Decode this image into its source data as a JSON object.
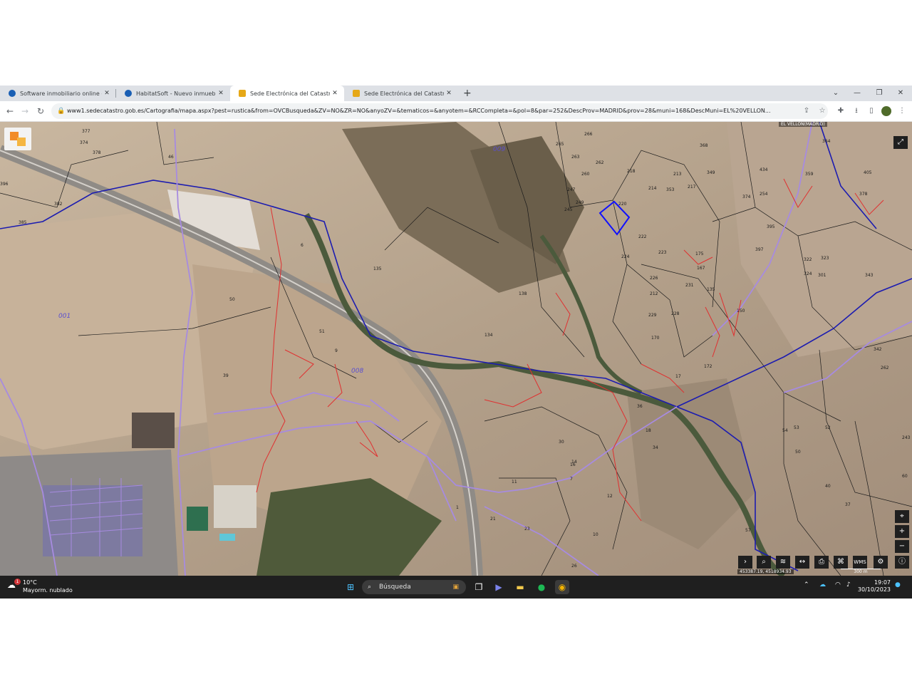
{
  "browser": {
    "tabs": [
      {
        "title": "Software inmobiliario online - H",
        "active": false,
        "icon": "habitatsoft-favicon"
      },
      {
        "title": "HabitatSoft - Nuevo inmueble",
        "active": false,
        "icon": "habitatsoft-favicon"
      },
      {
        "title": "Sede Electrónica del Catastro - ",
        "active": true,
        "icon": "catastro-favicon"
      },
      {
        "title": "Sede Electrónica del Catastro - ",
        "active": false,
        "icon": "catastro-favicon"
      }
    ],
    "new_tab_label": "+",
    "url": "www1.sedecatastro.gob.es/Cartografia/mapa.aspx?pest=rustica&from=OVCBusqueda&ZV=NO&ZR=NO&anyoZV=&tematicos=&anyotem=&RCCompleta=&pol=8&par=252&DescProv=MADRID&prov=28&muni=168&DescMuni=EL%20VELLON..."
  },
  "map": {
    "municipality_label": "EL VELLON(MADRID)",
    "coordinates": "453387.19, 4518934.93",
    "scale_label": "300 m",
    "polygon_labels": [
      "001",
      "008",
      "009"
    ],
    "parcel_labels": [
      "377",
      "374",
      "378",
      "46",
      "382",
      "385",
      "396",
      "50",
      "39",
      "51",
      "135",
      "138",
      "133",
      "134",
      "265",
      "263",
      "260",
      "266",
      "256",
      "262",
      "245",
      "247",
      "249",
      "275",
      "218",
      "216",
      "214",
      "213",
      "217",
      "353",
      "349",
      "368",
      "434",
      "359",
      "364",
      "405",
      "378",
      "374",
      "254",
      "220",
      "222",
      "224",
      "223",
      "226",
      "231",
      "212",
      "229",
      "228",
      "170",
      "175",
      "167",
      "135",
      "150",
      "172",
      "17",
      "18",
      "34",
      "30",
      "36",
      "14",
      "7",
      "11",
      "12",
      "16",
      "23",
      "21",
      "26",
      "10",
      "37",
      "40",
      "57",
      "54",
      "53",
      "52",
      "50",
      "60",
      "243",
      "262",
      "342",
      "343",
      "301",
      "323",
      "322",
      "324",
      "395",
      "397",
      "6",
      "9",
      "1"
    ],
    "toolbar_buttons": [
      "chevron-right",
      "search",
      "layers",
      "measure",
      "print",
      "coordinates",
      "WMS",
      "share",
      "info"
    ],
    "right_controls": [
      "locate",
      "zoom-in",
      "zoom-out"
    ],
    "colors": {
      "polygon_line": "#1c1cb0",
      "road_line": "#a78be0",
      "parcel_red": "#e03030",
      "parcel_black": "#1a1a1a",
      "selected_parcel": "#1010ff"
    }
  },
  "taskbar": {
    "weather_temp": "10°C",
    "weather_desc": "Mayorm. nublado",
    "weather_badge": "1",
    "search_placeholder": "Búsqueda",
    "time": "19:07",
    "date": "30/10/2023"
  }
}
